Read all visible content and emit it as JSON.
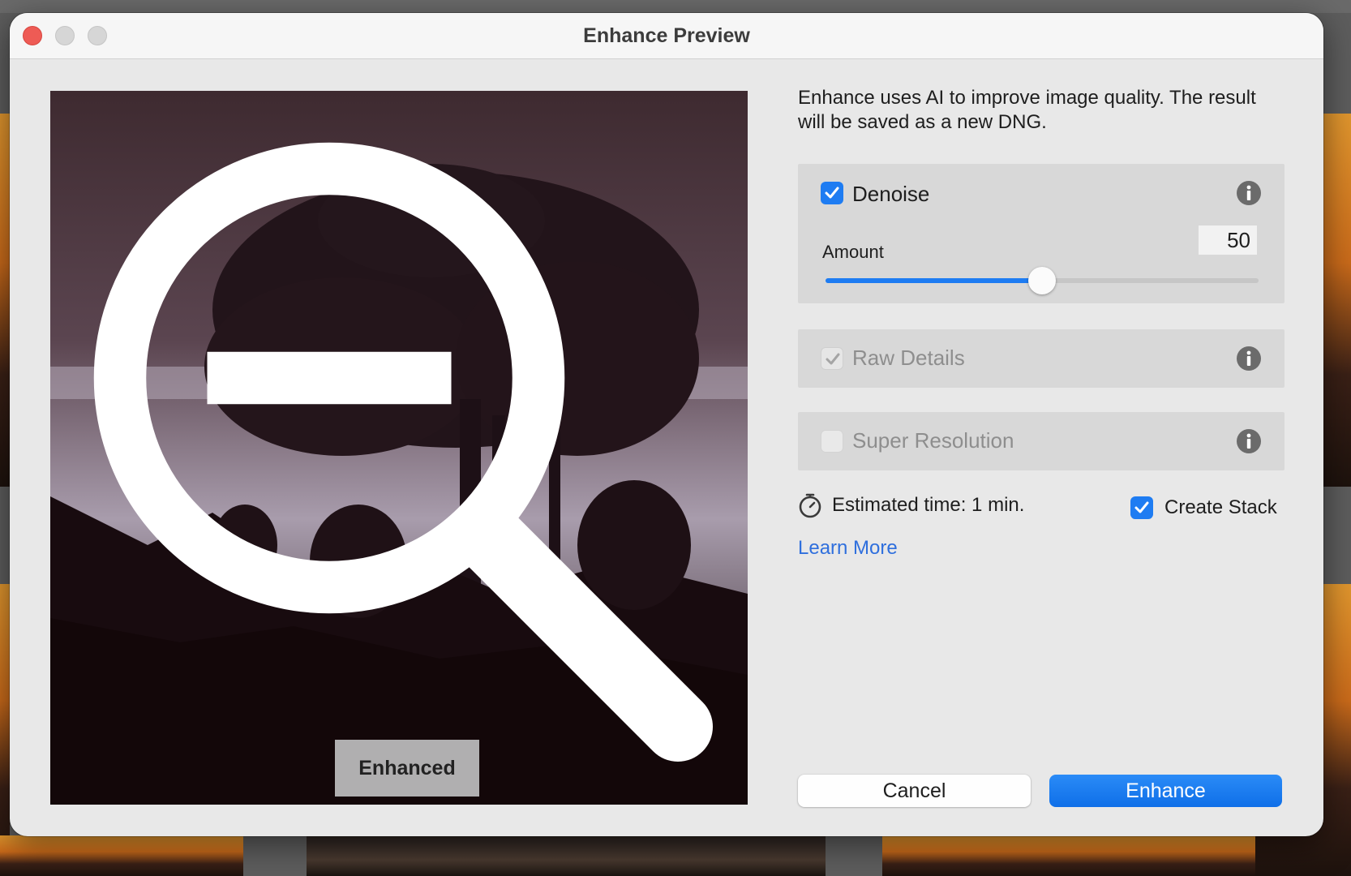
{
  "window": {
    "title": "Enhance Preview"
  },
  "preview": {
    "badge": "Enhanced"
  },
  "description": "Enhance uses AI to improve image quality. The result will be saved as a new DNG.",
  "denoise": {
    "label": "Denoise",
    "checked": true,
    "amount_label": "Amount",
    "amount_value": "50",
    "amount_fraction": 0.5
  },
  "raw_details": {
    "label": "Raw Details",
    "checked": true,
    "disabled": true
  },
  "super_resolution": {
    "label": "Super Resolution",
    "checked": false,
    "disabled": true
  },
  "estimate": {
    "text": "Estimated time: 1 min."
  },
  "create_stack": {
    "label": "Create Stack",
    "checked": true
  },
  "learn_more": "Learn More",
  "buttons": {
    "cancel": "Cancel",
    "enhance": "Enhance"
  },
  "colors": {
    "accent": "#1e7cf2",
    "link": "#2f6fdd",
    "close": "#ee5b55"
  }
}
